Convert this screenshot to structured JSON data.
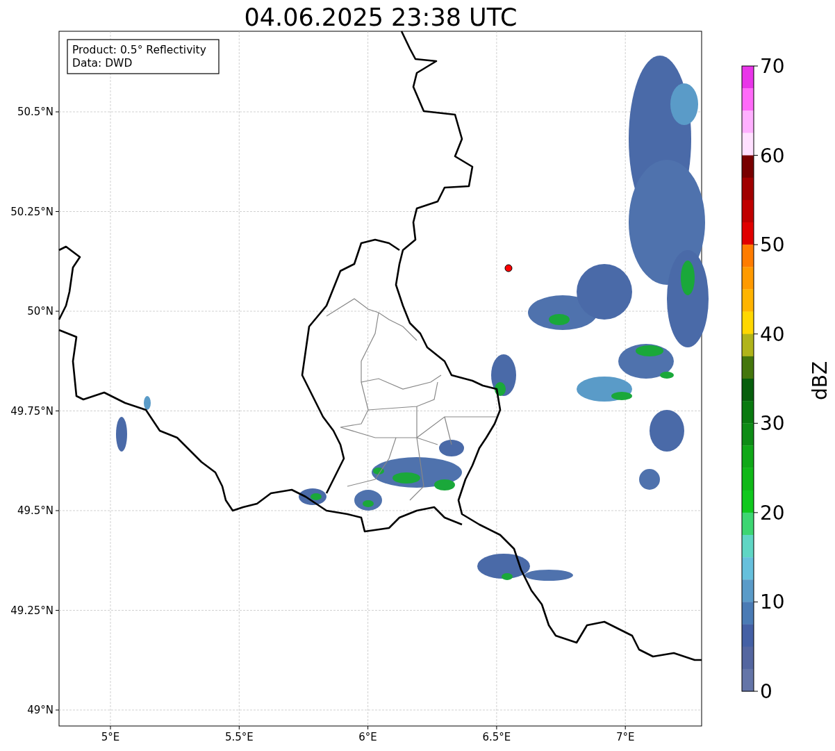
{
  "title": "04.06.2025 23:38 UTC",
  "info_box": [
    "Product: 0.5° Reflectivity",
    "Data: DWD"
  ],
  "map": {
    "x_ticks": [
      "5°E",
      "5.5°E",
      "6°E",
      "6.5°E",
      "7°E"
    ],
    "y_ticks": [
      "50.5°N",
      "50.25°N",
      "50°N",
      "49.75°N",
      "49.5°N",
      "49.25°N",
      "49°N"
    ]
  },
  "colorbar": {
    "label": "dBZ",
    "ticks": [
      "70",
      "60",
      "50",
      "40",
      "30",
      "20",
      "10",
      "0"
    ],
    "bands": [
      {
        "color": "#e935e9"
      },
      {
        "color": "#ff6af8"
      },
      {
        "color": "#ffb0ff"
      },
      {
        "color": "#ffe0ff"
      },
      {
        "color": "#780000"
      },
      {
        "color": "#a00000"
      },
      {
        "color": "#c00000"
      },
      {
        "color": "#e00000"
      },
      {
        "color": "#ff7c00"
      },
      {
        "color": "#ff9a00"
      },
      {
        "color": "#ffb400"
      },
      {
        "color": "#ffd700"
      },
      {
        "color": "#b0b41a"
      },
      {
        "color": "#44760c"
      },
      {
        "color": "#075e0c"
      },
      {
        "color": "#0a7a10"
      },
      {
        "color": "#0e8c16"
      },
      {
        "color": "#10a818"
      },
      {
        "color": "#10b818"
      },
      {
        "color": "#10c81e"
      },
      {
        "color": "#3dd672"
      },
      {
        "color": "#5fd6c4"
      },
      {
        "color": "#66c0dc"
      },
      {
        "color": "#5a9bc8"
      },
      {
        "color": "#4a7bb5"
      },
      {
        "color": "#4460a5"
      },
      {
        "color": "#5466a0"
      },
      {
        "color": "#6475a8"
      }
    ]
  }
}
